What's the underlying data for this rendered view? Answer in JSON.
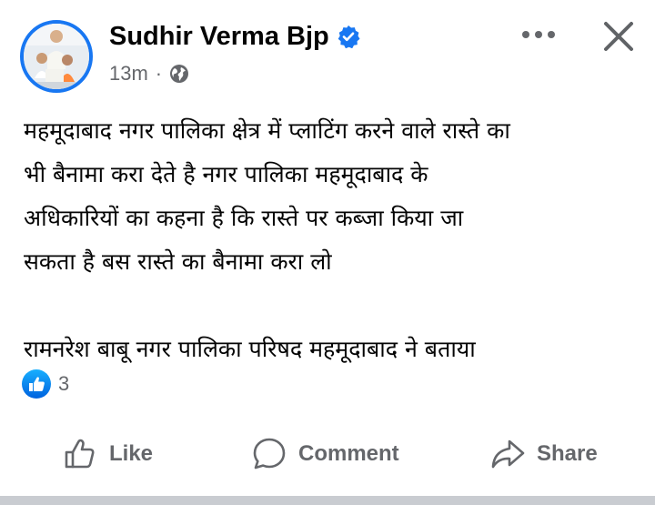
{
  "post": {
    "author": "Sudhir Verma Bjp",
    "timestamp": "13m",
    "separator": "·",
    "privacy_icon": "globe-icon",
    "verified_icon": "verified-badge-icon",
    "more_icon": "more-options-icon",
    "close_icon": "close-icon",
    "text_lines": [
      "महमूदाबाद नगर पालिका क्षेत्र में प्लाटिंग करने वाले रास्ते का",
      "भी बैनामा करा देते है नगर पालिका महमूदाबाद के",
      "अधिकारियों का कहना है कि रास्ते पर कब्जा किया जा",
      "सकता है बस रास्ते का बैनामा करा लो"
    ],
    "text_footer": "रामनरेश बाबू नगर पालिका परिषद महमूदाबाद ने बताया",
    "reactions": {
      "icon": "like-reaction-icon",
      "count": "3"
    }
  },
  "actions": {
    "like_label": "Like",
    "comment_label": "Comment",
    "share_label": "Share"
  },
  "colors": {
    "accent": "#1877f2",
    "text_primary": "#050505",
    "text_secondary": "#65676b",
    "divider": "#c9ccd1"
  }
}
